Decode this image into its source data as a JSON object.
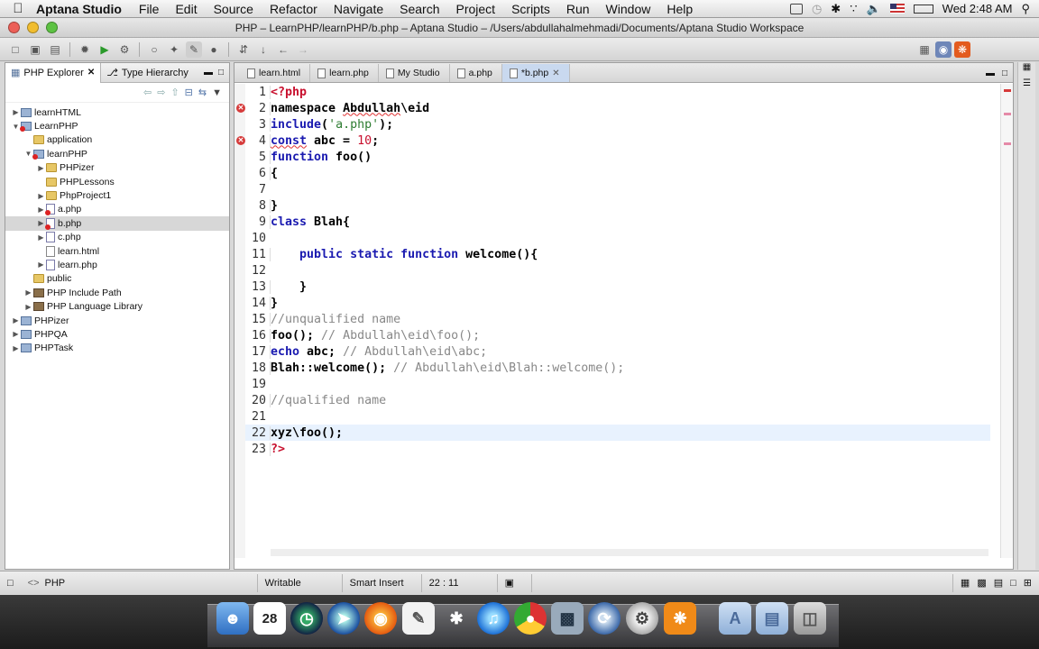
{
  "menubar": {
    "app_name": "Aptana Studio",
    "items": [
      "File",
      "Edit",
      "Source",
      "Refactor",
      "Navigate",
      "Search",
      "Project",
      "Scripts",
      "Run",
      "Window",
      "Help"
    ],
    "clock": "Wed 2:48 AM"
  },
  "window": {
    "title": "PHP – LearnPHP/learnPHP/b.php – Aptana Studio – /Users/abdullahalmehmadi/Documents/Aptana Studio Workspace"
  },
  "explorer": {
    "tabs": [
      {
        "label": "PHP Explorer",
        "active": true
      },
      {
        "label": "Type Hierarchy",
        "active": false
      }
    ],
    "tree": [
      {
        "label": "learnHTML",
        "depth": 0,
        "icon": "project-icon",
        "twisty": "▶",
        "selected": false
      },
      {
        "label": "LearnPHP",
        "depth": 0,
        "icon": "project-error-icon",
        "twisty": "▼",
        "selected": false
      },
      {
        "label": "application",
        "depth": 1,
        "icon": "folder-icon",
        "twisty": "",
        "selected": false
      },
      {
        "label": "learnPHP",
        "depth": 1,
        "icon": "package-error-icon",
        "twisty": "▼",
        "selected": false
      },
      {
        "label": "PHPizer",
        "depth": 2,
        "icon": "folder-icon",
        "twisty": "▶",
        "selected": false
      },
      {
        "label": "PHPLessons",
        "depth": 2,
        "icon": "folder-icon",
        "twisty": "",
        "selected": false
      },
      {
        "label": "PhpProject1",
        "depth": 2,
        "icon": "folder-icon",
        "twisty": "▶",
        "selected": false
      },
      {
        "label": "a.php",
        "depth": 2,
        "icon": "php-file-error-icon",
        "twisty": "▶",
        "selected": false
      },
      {
        "label": "b.php",
        "depth": 2,
        "icon": "php-file-error-icon",
        "twisty": "▶",
        "selected": true
      },
      {
        "label": "c.php",
        "depth": 2,
        "icon": "php-file-icon",
        "twisty": "▶",
        "selected": false
      },
      {
        "label": "learn.html",
        "depth": 2,
        "icon": "html-file-icon",
        "twisty": "",
        "selected": false
      },
      {
        "label": "learn.php",
        "depth": 2,
        "icon": "php-file-icon",
        "twisty": "▶",
        "selected": false
      },
      {
        "label": "public",
        "depth": 1,
        "icon": "folder-icon",
        "twisty": "",
        "selected": false
      },
      {
        "label": "PHP Include Path",
        "depth": 1,
        "icon": "library-icon",
        "twisty": "▶",
        "selected": false
      },
      {
        "label": "PHP Language Library",
        "depth": 1,
        "icon": "library-icon",
        "twisty": "▶",
        "selected": false
      },
      {
        "label": "PHPizer",
        "depth": 0,
        "icon": "project-icon",
        "twisty": "▶",
        "selected": false
      },
      {
        "label": "PHPQA",
        "depth": 0,
        "icon": "project-icon",
        "twisty": "▶",
        "selected": false
      },
      {
        "label": "PHPTask",
        "depth": 0,
        "icon": "project-icon",
        "twisty": "▶",
        "selected": false
      }
    ]
  },
  "editor": {
    "tabs": [
      {
        "label": "learn.html",
        "active": false
      },
      {
        "label": "learn.php",
        "active": false
      },
      {
        "label": "My Studio",
        "active": false
      },
      {
        "label": "a.php",
        "active": false
      },
      {
        "label": "*b.php",
        "active": true
      }
    ],
    "current_line": 22,
    "error_lines": [
      2,
      4
    ],
    "lines": [
      {
        "n": "1",
        "tokens": [
          {
            "t": "<?php",
            "c": "tag"
          }
        ]
      },
      {
        "n": "2",
        "tokens": [
          {
            "t": "namespace ",
            "c": "plain"
          },
          {
            "t": "Abdullah",
            "c": "plain wavy"
          },
          {
            "t": "\\eid",
            "c": "plain"
          }
        ]
      },
      {
        "n": "3",
        "tokens": [
          {
            "t": "include",
            "c": "kw"
          },
          {
            "t": "(",
            "c": "plain"
          },
          {
            "t": "'a.php'",
            "c": "str"
          },
          {
            "t": ");",
            "c": "plain"
          }
        ]
      },
      {
        "n": "4",
        "tokens": [
          {
            "t": "const",
            "c": "kw wavy"
          },
          {
            "t": " abc = ",
            "c": "plain"
          },
          {
            "t": "10",
            "c": "num"
          },
          {
            "t": ";",
            "c": "plain"
          }
        ]
      },
      {
        "n": "5",
        "tokens": [
          {
            "t": "function",
            "c": "kw"
          },
          {
            "t": " foo()",
            "c": "plain"
          }
        ]
      },
      {
        "n": "6",
        "tokens": [
          {
            "t": "{",
            "c": "plain"
          }
        ]
      },
      {
        "n": "7",
        "tokens": []
      },
      {
        "n": "8",
        "tokens": [
          {
            "t": "}",
            "c": "plain"
          }
        ]
      },
      {
        "n": "9",
        "tokens": [
          {
            "t": "class",
            "c": "kw"
          },
          {
            "t": " Blah{",
            "c": "plain"
          }
        ]
      },
      {
        "n": "10",
        "tokens": []
      },
      {
        "n": "11",
        "tokens": [
          {
            "t": "    ",
            "c": "plain"
          },
          {
            "t": "public static function",
            "c": "kw"
          },
          {
            "t": " welcome(){",
            "c": "plain"
          }
        ]
      },
      {
        "n": "12",
        "tokens": []
      },
      {
        "n": "13",
        "tokens": [
          {
            "t": "    }",
            "c": "plain"
          }
        ]
      },
      {
        "n": "14",
        "tokens": [
          {
            "t": "}",
            "c": "plain"
          }
        ]
      },
      {
        "n": "15",
        "tokens": [
          {
            "t": "//unqualified name",
            "c": "cm"
          }
        ]
      },
      {
        "n": "16",
        "tokens": [
          {
            "t": "foo(); ",
            "c": "plain"
          },
          {
            "t": "// Abdullah\\eid\\foo();",
            "c": "cm"
          }
        ]
      },
      {
        "n": "17",
        "tokens": [
          {
            "t": "echo",
            "c": "kw"
          },
          {
            "t": " abc; ",
            "c": "plain"
          },
          {
            "t": "// Abdullah\\eid\\abc;",
            "c": "cm"
          }
        ]
      },
      {
        "n": "18",
        "tokens": [
          {
            "t": "Blah::welcome(); ",
            "c": "plain"
          },
          {
            "t": "// Abdullah\\eid\\Blah::welcome();",
            "c": "cm"
          }
        ]
      },
      {
        "n": "19",
        "tokens": []
      },
      {
        "n": "20",
        "tokens": [
          {
            "t": "//qualified name",
            "c": "cm"
          }
        ]
      },
      {
        "n": "21",
        "tokens": []
      },
      {
        "n": "22",
        "tokens": [
          {
            "t": "xyz\\foo();",
            "c": "plain"
          }
        ]
      },
      {
        "n": "23",
        "tokens": [
          {
            "t": "?>",
            "c": "tag"
          }
        ]
      }
    ]
  },
  "statusbar": {
    "language": "PHP",
    "writable": "Writable",
    "insert_mode": "Smart Insert",
    "position": "22 : 11"
  },
  "dock": {
    "calendar_day": "28"
  },
  "colors": {
    "keyword": "#1a1ab0",
    "tag": "#c8102e",
    "string": "#2e7d32",
    "comment": "#888888",
    "current_line": "#e8f2fe",
    "error": "#d63a3a"
  }
}
